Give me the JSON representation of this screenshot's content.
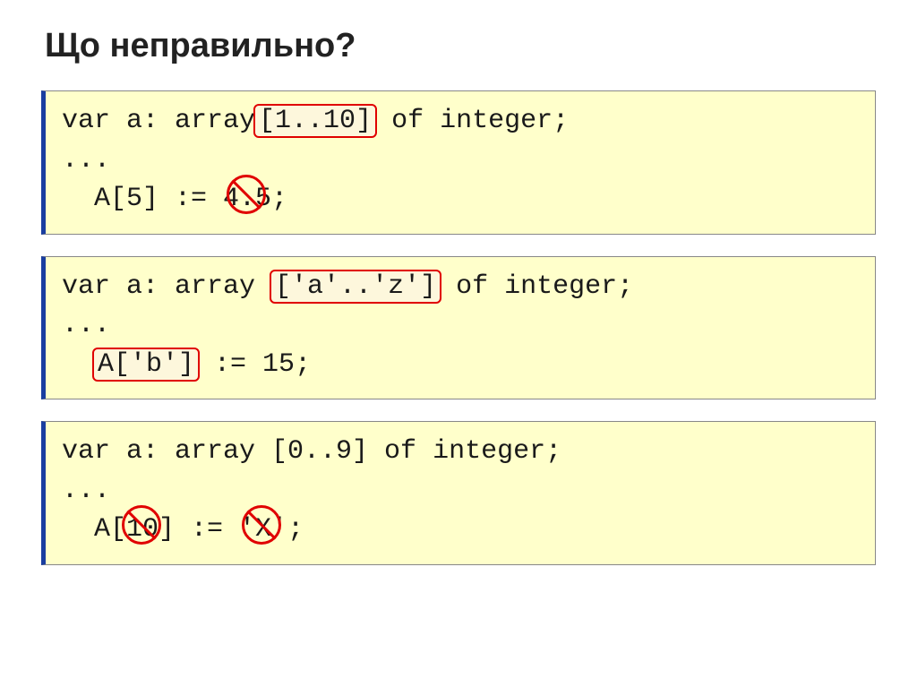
{
  "title": "Що неправильно?",
  "blocks": [
    {
      "l1a": "var a: array",
      "l1b": "[1..10]",
      "l1c": " of integer;",
      "l2": "...",
      "l3a": "  A[5] := ",
      "l3b": "4.5",
      "l3c": ";"
    },
    {
      "l1a": "var a: array ",
      "l1b": "['a'..'z']",
      "l1c": " of integer;",
      "l2": "...",
      "l3a": "  ",
      "l3b": "A['b']",
      "l3c": " := 15;"
    },
    {
      "l1": "var a: array [0..9] of integer;",
      "l2": "...",
      "l3a": "  A[",
      "l3b": "10",
      "l3c": "] := ",
      "l3d": "'X'",
      "l3e": ";"
    }
  ]
}
